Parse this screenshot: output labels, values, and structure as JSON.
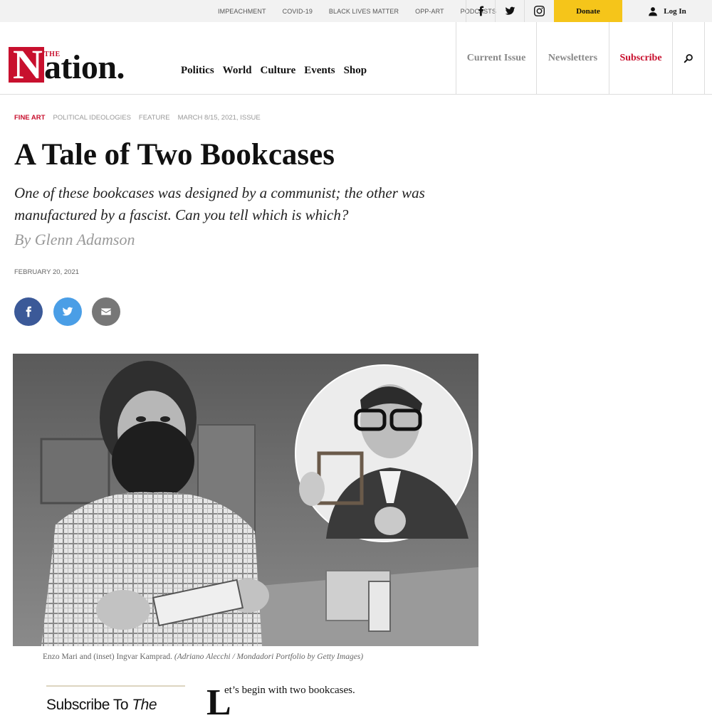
{
  "topbar": {
    "links": [
      "IMPEACHMENT",
      "COVID-19",
      "BLACK LIVES MATTER",
      "OPP-ART",
      "PODCASTS"
    ],
    "social": [
      {
        "name": "facebook-icon"
      },
      {
        "name": "twitter-icon"
      },
      {
        "name": "instagram-icon"
      }
    ],
    "donate_label": "Donate",
    "login_label": "Log In",
    "donate_color": "#f5c51a"
  },
  "header": {
    "logo_the": "THE",
    "logo_n": "N",
    "logo_rest": "ation.",
    "nav": [
      "Politics",
      "World",
      "Culture",
      "Events",
      "Shop"
    ],
    "current_issue": "Current Issue",
    "newsletters": "Newsletters",
    "subscribe": "Subscribe",
    "brand_color": "#c8102e"
  },
  "article": {
    "tags": [
      "FINE ART",
      "POLITICAL IDEOLOGIES",
      "FEATURE",
      "MARCH 8/15, 2021, ISSUE"
    ],
    "title": "A Tale of Two Bookcases",
    "dek": "One of these bookcases was designed by a communist; the other was manufactured by a fascist. Can you tell which is which?",
    "byline": "By Glenn Adamson",
    "date": "FEBRUARY 20, 2021",
    "share": [
      {
        "name": "facebook-share",
        "color": "#3b5998"
      },
      {
        "name": "twitter-share",
        "color": "#4a9ee6"
      },
      {
        "name": "email-share",
        "color": "#777777"
      }
    ],
    "caption_main": "Enzo Mari and (inset) Ingvar Kamprad.",
    "caption_credit": "(Adriano Alecchi / Mondadori Portfolio by Getty Images)",
    "subscribe_prefix": "Subscribe To ",
    "subscribe_italic": "The",
    "dropcap": "L",
    "body_start": "et’s begin with two bookcases."
  }
}
